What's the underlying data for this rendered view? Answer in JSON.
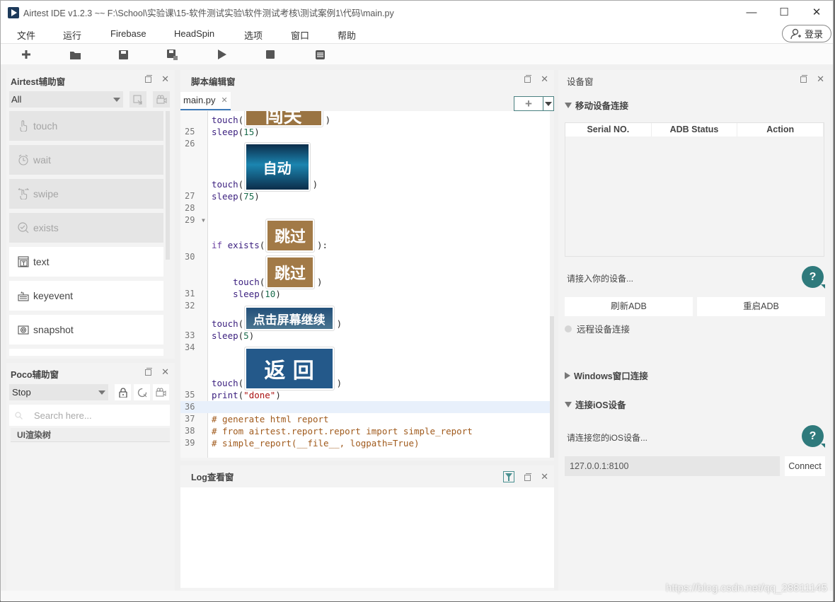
{
  "window": {
    "title": "Airtest IDE v1.2.3 ~~ F:\\School\\实验课\\15-软件测试实验\\软件测试考核\\测试案例1\\代码\\main.py",
    "controls": [
      "minimize",
      "maximize",
      "close"
    ]
  },
  "menubar": {
    "items": [
      "文件",
      "运行",
      "Firebase",
      "HeadSpin",
      "选项",
      "窗口",
      "帮助"
    ],
    "login_label": "登录"
  },
  "toolbar": {
    "buttons": [
      "new-file",
      "open-file",
      "save",
      "save-as",
      "run",
      "stop",
      "view-log"
    ]
  },
  "airtest_panel": {
    "title": "Airtest辅助窗",
    "filter_value": "All",
    "commands": [
      {
        "label": "touch",
        "icon": "touch-icon",
        "enabled": false
      },
      {
        "label": "wait",
        "icon": "clock-icon",
        "enabled": false
      },
      {
        "label": "swipe",
        "icon": "swipe-icon",
        "enabled": false
      },
      {
        "label": "exists",
        "icon": "check-search-icon",
        "enabled": false
      },
      {
        "label": "text",
        "icon": "text-icon",
        "enabled": true
      },
      {
        "label": "keyevent",
        "icon": "keyboard-icon",
        "enabled": true
      },
      {
        "label": "snapshot",
        "icon": "camera-icon",
        "enabled": true
      }
    ]
  },
  "poco_panel": {
    "title": "Poco辅助窗",
    "mode_value": "Stop",
    "search_placeholder": "Search here...",
    "tree_header": "UI渲染树"
  },
  "editor": {
    "title": "脚本编辑窗",
    "tab_label": "main.py",
    "lines": [
      {
        "num": "",
        "code": "touch(",
        "suffix": ")",
        "image": "闯关",
        "kind": "touch"
      },
      {
        "num": "25",
        "code": "sleep(15)"
      },
      {
        "num": "26",
        "code": ""
      },
      {
        "num": "",
        "code": "touch(",
        "suffix": ")",
        "image": "自动",
        "kind": "touch"
      },
      {
        "num": "27",
        "code": "sleep(75)"
      },
      {
        "num": "28",
        "code": ""
      },
      {
        "num": "29",
        "code": "",
        "fold": true
      },
      {
        "num": "",
        "code": "if exists(",
        "suffix": "):",
        "image": "跳过",
        "kind": "if"
      },
      {
        "num": "30",
        "code": ""
      },
      {
        "num": "",
        "code": "    touch(",
        "suffix": ")",
        "image": "跳过",
        "kind": "touch"
      },
      {
        "num": "31",
        "code": "    sleep(10)"
      },
      {
        "num": "32",
        "code": ""
      },
      {
        "num": "",
        "code": "touch(",
        "suffix": ")",
        "image": "点击屏幕继续",
        "kind": "touch"
      },
      {
        "num": "33",
        "code": "sleep(5)"
      },
      {
        "num": "34",
        "code": ""
      },
      {
        "num": "",
        "code": "touch(",
        "suffix": ")",
        "image": "返 回",
        "kind": "touch"
      },
      {
        "num": "35",
        "code": "print(\"done\")"
      },
      {
        "num": "36",
        "code": ""
      },
      {
        "num": "37",
        "code": "# generate html report"
      },
      {
        "num": "38",
        "code": "# from airtest.report.report import simple_report"
      },
      {
        "num": "39",
        "code": "# simple_report(__file__, logpath=True)"
      }
    ]
  },
  "log_panel": {
    "title": "Log查看窗"
  },
  "device_panel": {
    "title": "设备窗",
    "mobile_section": "移动设备连接",
    "table_headers": [
      "Serial NO.",
      "ADB Status",
      "Action"
    ],
    "connect_hint": "请接入你的设备...",
    "refresh_adb": "刷新ADB",
    "restart_adb": "重启ADB",
    "remote_connect": "远程设备连接",
    "windows_section": "Windows窗口连接",
    "ios_section": "连接iOS设备",
    "ios_hint": "请连接您的iOS设备...",
    "ios_address": "127.0.0.1:8100",
    "connect_label": "Connect",
    "help_label": "?"
  },
  "watermark": "https://blog.csdn.net/qq_28811145"
}
